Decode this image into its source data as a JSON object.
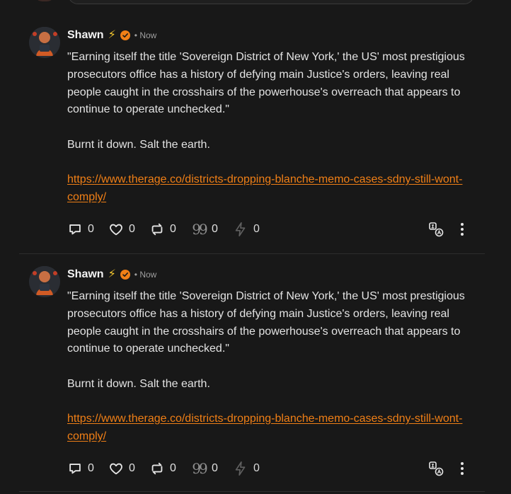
{
  "notes": [
    {
      "author": "Shawn",
      "timestamp": "• Now",
      "text": "\"Earning itself the title 'Sovereign District of New York,' the US' most prestigious prosecutors office has a history of defying main Justice's orders, leaving real people caught in the crosshairs of the powerhouse's overreach that appears to continue to operate unchecked.\"",
      "comment": "Burnt it down. Salt the earth.",
      "link": "https://www.therage.co/districts-dropping-blanche-memo-cases-sdny-still-wont-comply/",
      "counts": {
        "reply": "0",
        "like": "0",
        "repost": "0",
        "quote": "0",
        "zap": "0"
      }
    },
    {
      "author": "Shawn",
      "timestamp": "• Now",
      "text": "\"Earning itself the title 'Sovereign District of New York,' the US' most prestigious prosecutors office has a history of defying main Justice's orders, leaving real people caught in the crosshairs of the powerhouse's overreach that appears to continue to operate unchecked.\"",
      "comment": "Burnt it down. Salt the earth.",
      "link": "https://www.therage.co/districts-dropping-blanche-memo-cases-sdny-still-wont-comply/",
      "counts": {
        "reply": "0",
        "like": "0",
        "repost": "0",
        "quote": "0",
        "zap": "0"
      }
    }
  ],
  "icons": {
    "author_badge": "lightning-icon",
    "verified": "verified-badge-icon",
    "reply": "comment-icon",
    "like": "heart-icon",
    "repost": "repost-icon",
    "quote": "quote-icon",
    "zap": "zap-icon",
    "translate": "translate-icon",
    "more": "more-vertical-icon"
  },
  "colors": {
    "background": "#181818",
    "accent": "#f07f16",
    "text": "#e3e3e3",
    "muted": "#9e9e9e"
  }
}
